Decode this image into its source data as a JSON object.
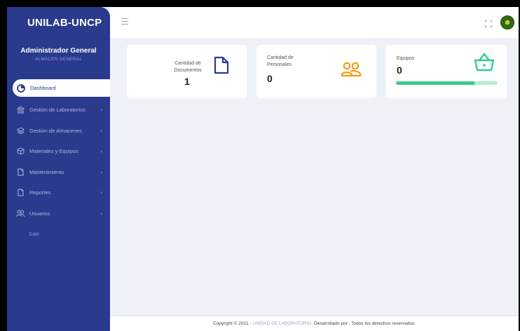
{
  "app": {
    "brand": "UNILAB-UNCP"
  },
  "profile": {
    "role": "Administrador General",
    "subtitle": "ALMACEN GENERAL"
  },
  "sidebar": {
    "items": [
      {
        "label": "Dashboard",
        "icon": "pie-chart-icon",
        "active": true
      },
      {
        "label": "Gestión de Laboratorios",
        "icon": "bank-icon",
        "chevron": "›"
      },
      {
        "label": "Gestión de Almacenes",
        "icon": "layers-icon",
        "chevron": "›"
      },
      {
        "label": "Materiales y Equipos",
        "icon": "box-icon",
        "chevron": "›"
      },
      {
        "label": "Mantenimiento",
        "icon": "file-icon",
        "chevron": "›"
      },
      {
        "label": "Reportes",
        "icon": "file-icon",
        "chevron": "›"
      },
      {
        "label": "Usuarios",
        "icon": "users-icon",
        "chevron": "›"
      },
      {
        "label": "Salir"
      }
    ]
  },
  "cards": {
    "documentos": {
      "label_line1": "Cantidad de",
      "label_line2": "Documentos",
      "value": "1",
      "icon": "document-icon",
      "color": "#2a3a8c"
    },
    "personales": {
      "label_line1": "Cantidad de",
      "label_line2": "Personales",
      "value": "0",
      "icon": "people-icon",
      "color": "#f39c12"
    },
    "equipos": {
      "label": "Equipos",
      "value": "0",
      "icon": "basket-icon",
      "color": "#2ecc8f",
      "progress_fraction": 0.77
    }
  },
  "footer": {
    "prefix": "Copyright © 2021 -",
    "org": "UNIDAD DE LABORATORIO.",
    "suffix": "Desarrollado por . Todos los derechos reservados."
  }
}
